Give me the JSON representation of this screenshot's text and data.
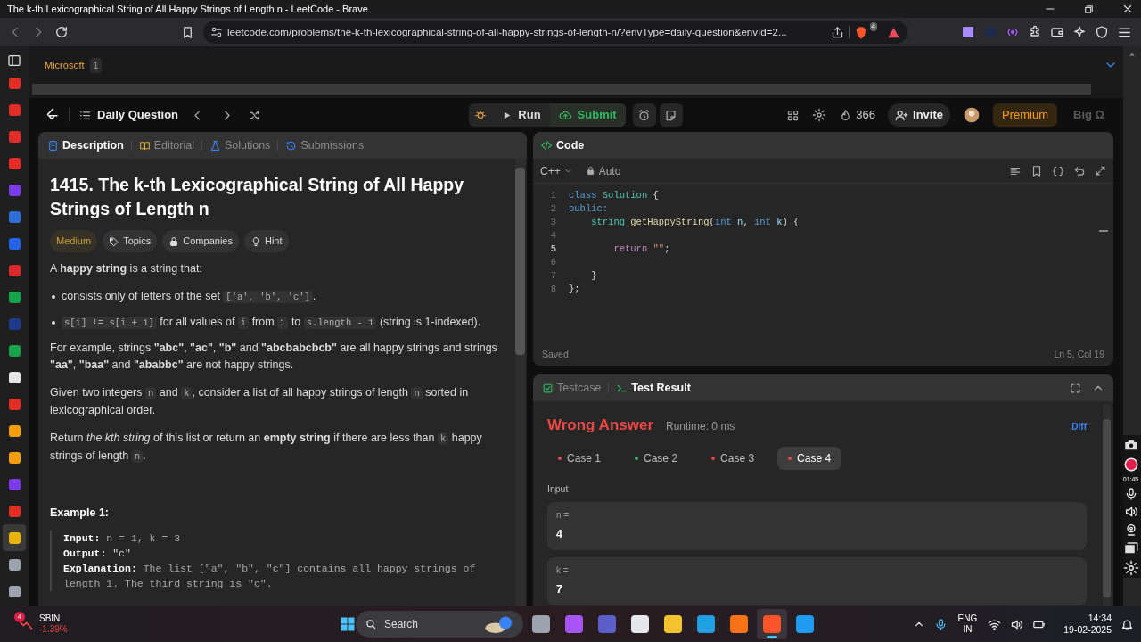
{
  "window": {
    "title": "The k-th Lexicographical String of All Happy Strings of Length n - LeetCode - Brave"
  },
  "browser": {
    "url": "leetcode.com/problems/the-k-th-lexicographical-string-of-all-happy-strings-of-length-n/?envType=daily-question&envId=2...",
    "shields_badge": "4"
  },
  "sidebar": {
    "items": [
      {
        "color": "#e52d27",
        "selected": false
      },
      {
        "color": "#e52d27",
        "selected": false
      },
      {
        "color": "#e52d27",
        "selected": false
      },
      {
        "color": "#e52d27",
        "selected": false
      },
      {
        "color": "#7c3aed",
        "selected": false
      },
      {
        "color": "#2d6fd6",
        "selected": false
      },
      {
        "color": "#2563eb",
        "selected": false
      },
      {
        "color": "#d92b2b",
        "selected": false
      },
      {
        "color": "#16a34a",
        "selected": false
      },
      {
        "color": "#1e3a8a",
        "selected": false
      },
      {
        "color": "#16a34a",
        "selected": false
      },
      {
        "color": "#e5e5e5",
        "selected": false
      },
      {
        "color": "#e52d27",
        "selected": false
      },
      {
        "color": "#f59e0b",
        "selected": false
      },
      {
        "color": "#f59e0b",
        "selected": false
      },
      {
        "color": "#7c3aed",
        "selected": false
      },
      {
        "color": "#e52d27",
        "selected": false
      },
      {
        "color": "#eab308",
        "selected": true
      },
      {
        "color": "#9ca3af",
        "selected": false
      },
      {
        "color": "#9ca3af",
        "selected": false
      }
    ]
  },
  "company_tags": [
    {
      "name": "Microsoft",
      "count": "1"
    }
  ],
  "nav": {
    "title": "Daily Question",
    "run": "Run",
    "submit": "Submit",
    "streak": "366",
    "invite": "Invite",
    "premium": "Premium",
    "faded_label": "Big Ω"
  },
  "description_tabs": [
    {
      "label": "Description",
      "selected": true
    },
    {
      "label": "Editorial",
      "selected": false
    },
    {
      "label": "Solutions",
      "selected": false
    },
    {
      "label": "Submissions",
      "selected": false
    }
  ],
  "problem": {
    "title": "1415. The k-th Lexicographical String of All Happy Strings of Length n",
    "difficulty": "Medium",
    "tags": [
      "Topics",
      "Companies",
      "Hint"
    ],
    "blocks": [
      {
        "kind": "paragraph",
        "segments": [
          {
            "kind": "text",
            "text": "A **happy string** is a string that:"
          }
        ]
      },
      {
        "kind": "bullet",
        "segments": [
          {
            "kind": "text",
            "text": "consists only of letters of the set "
          },
          {
            "kind": "code",
            "text": "['a', 'b', 'c']"
          },
          {
            "kind": "text",
            "text": "."
          }
        ]
      },
      {
        "kind": "bullet",
        "segments": [
          {
            "kind": "code",
            "text": "s[i] != s[i + 1]"
          },
          {
            "kind": "text",
            "text": " for all values of "
          },
          {
            "kind": "code",
            "text": "i"
          },
          {
            "kind": "text",
            "text": " from "
          },
          {
            "kind": "code",
            "text": "1"
          },
          {
            "kind": "text",
            "text": " to "
          },
          {
            "kind": "code",
            "text": "s.length - 1"
          },
          {
            "kind": "text",
            "text": " (string is 1-indexed)."
          }
        ]
      },
      {
        "kind": "paragraph",
        "segments": [
          {
            "kind": "text",
            "text": "For example, strings **\"abc\"**, **\"ac\"**, **\"b\"** and **\"abcbabcbcb\"** are all happy strings and strings **\"aa\"**, **\"baa\"** and **\"ababbc\"** are not happy strings."
          }
        ]
      },
      {
        "kind": "paragraph",
        "segments": [
          {
            "kind": "text",
            "text": "Given two integers "
          },
          {
            "kind": "code",
            "text": "n"
          },
          {
            "kind": "text",
            "text": " and "
          },
          {
            "kind": "code",
            "text": "k"
          },
          {
            "kind": "text",
            "text": ", consider a list of all happy strings of length "
          },
          {
            "kind": "code",
            "text": "n"
          },
          {
            "kind": "text",
            "text": " sorted in lexicographical order."
          }
        ]
      },
      {
        "kind": "paragraph",
        "segments": [
          {
            "kind": "text",
            "text": "Return *the kth string* of this list or return an **empty string** if there are less than "
          },
          {
            "kind": "code",
            "text": "k"
          },
          {
            "kind": "text",
            "text": " happy strings of length "
          },
          {
            "kind": "code",
            "text": "n"
          },
          {
            "kind": "text",
            "text": "."
          }
        ]
      }
    ],
    "example": {
      "heading": "Example 1:",
      "lines": [
        {
          "label": "Input:",
          "value": "n = 1, k = 3"
        },
        {
          "label": "Output:",
          "value": "\"c\""
        },
        {
          "label": "Explanation:",
          "value": "The list [\"a\", \"b\", \"c\"] contains all happy strings of length 1. The third string is \"c\"."
        }
      ]
    }
  },
  "code_panel": {
    "title": "Code",
    "language": "C++",
    "mode": "Auto",
    "status": "Saved",
    "cursor": "Ln 5, Col 19",
    "lines": [
      {
        "number": "1",
        "active": false,
        "tokens": [
          {
            "kind": "keyword",
            "text": "class "
          },
          {
            "kind": "type",
            "text": "Solution"
          },
          {
            "kind": "punct",
            "text": " {"
          }
        ]
      },
      {
        "number": "2",
        "active": false,
        "tokens": [
          {
            "kind": "keyword",
            "text": "public:"
          }
        ]
      },
      {
        "number": "3",
        "active": false,
        "tokens": [
          {
            "kind": "type",
            "text": "    string "
          },
          {
            "kind": "function",
            "text": "getHappyString"
          },
          {
            "kind": "punct",
            "text": "("
          },
          {
            "kind": "keyword",
            "text": "int "
          },
          {
            "kind": "param",
            "text": "n"
          },
          {
            "kind": "punct",
            "text": ", "
          },
          {
            "kind": "keyword",
            "text": "int "
          },
          {
            "kind": "param",
            "text": "k"
          },
          {
            "kind": "punct",
            "text": ") {"
          }
        ]
      },
      {
        "number": "4",
        "active": false
      },
      {
        "number": "5",
        "active": true,
        "tokens": [
          {
            "kind": "control",
            "text": "        return "
          },
          {
            "kind": "string",
            "text": "\"\""
          },
          {
            "kind": "punct",
            "text": ";"
          }
        ]
      },
      {
        "number": "6",
        "active": false
      },
      {
        "number": "7",
        "active": false,
        "tokens": [
          {
            "kind": "punct",
            "text": "    }"
          }
        ]
      },
      {
        "number": "8",
        "active": false,
        "tokens": [
          {
            "kind": "punct",
            "text": "};"
          }
        ]
      }
    ]
  },
  "test_panel": {
    "tabs": [
      {
        "label": "Testcase",
        "selected": false
      },
      {
        "label": "Test Result",
        "selected": true
      }
    ],
    "verdict": "Wrong Answer",
    "runtime": "Runtime: 0 ms",
    "diff": "Diff",
    "cases": [
      {
        "label": "Case 1",
        "passed": false,
        "selected": false
      },
      {
        "label": "Case 2",
        "passed": true,
        "selected": false
      },
      {
        "label": "Case 3",
        "passed": false,
        "selected": false
      },
      {
        "label": "Case 4",
        "passed": false,
        "selected": true
      }
    ],
    "input_heading": "Input",
    "inputs": [
      {
        "name": "n =",
        "value": "4"
      },
      {
        "name": "k =",
        "value": "7"
      }
    ]
  },
  "recorder": {
    "timer": "01:45"
  },
  "taskbar": {
    "stock": {
      "badge": "4",
      "name": "SBIN",
      "change": "-1.39%"
    },
    "search": "Search",
    "apps": [
      {
        "color": "#9ca3af",
        "selected": false
      },
      {
        "color": "#a855f7",
        "selected": false
      },
      {
        "color": "#5b5fc7",
        "selected": false
      },
      {
        "color": "#e5e7eb",
        "selected": false
      },
      {
        "color": "#f4c430",
        "selected": false
      },
      {
        "color": "#1fa0e3",
        "selected": false
      },
      {
        "color": "#f97316",
        "selected": false
      },
      {
        "color": "#fb542b",
        "selected": true
      },
      {
        "color": "#1f9cf0",
        "selected": false
      }
    ],
    "language": "ENG",
    "region": "IN",
    "time": "14:34",
    "date": "19-02-2025"
  }
}
